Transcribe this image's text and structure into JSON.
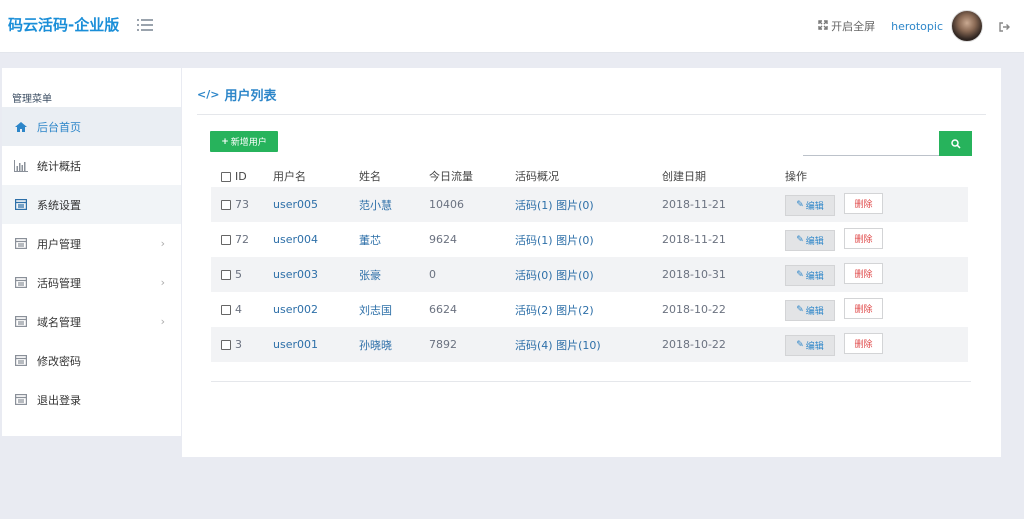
{
  "brand": "码云活码-企业版",
  "header": {
    "fullscreen_label": "开启全屏",
    "username": "herotopic"
  },
  "sidebar": {
    "title": "管理菜单",
    "items": [
      {
        "label": "后台首页",
        "icon": "home-icon"
      },
      {
        "label": "统计概括",
        "icon": "bar-chart-icon"
      },
      {
        "label": "系统设置",
        "icon": "panel-icon"
      },
      {
        "label": "用户管理",
        "icon": "panel-icon",
        "has_submenu": true
      },
      {
        "label": "活码管理",
        "icon": "panel-icon",
        "has_submenu": true
      },
      {
        "label": "域名管理",
        "icon": "panel-icon",
        "has_submenu": true
      },
      {
        "label": "修改密码",
        "icon": "panel-icon"
      },
      {
        "label": "退出登录",
        "icon": "panel-icon"
      }
    ]
  },
  "main": {
    "title": "用户列表",
    "add_button": "新增用户",
    "search_placeholder": "",
    "table": {
      "headers": [
        "ID",
        "用户名",
        "姓名",
        "今日流量",
        "活码概况",
        "创建日期",
        "操作"
      ],
      "rows": [
        {
          "id": "73",
          "username": "user005",
          "name": "范小慧",
          "traffic": "10406",
          "codes": "活码(1) 图片(0)",
          "date": "2018-11-21"
        },
        {
          "id": "72",
          "username": "user004",
          "name": "董芯",
          "traffic": "9624",
          "codes": "活码(1) 图片(0)",
          "date": "2018-11-21"
        },
        {
          "id": "5",
          "username": "user003",
          "name": "张豪",
          "traffic": "0",
          "codes": "活码(0) 图片(0)",
          "date": "2018-10-31"
        },
        {
          "id": "4",
          "username": "user002",
          "name": "刘志国",
          "traffic": "6624",
          "codes": "活码(2) 图片(2)",
          "date": "2018-10-22"
        },
        {
          "id": "3",
          "username": "user001",
          "name": "孙晓晓",
          "traffic": "7892",
          "codes": "活码(4) 图片(10)",
          "date": "2018-10-22"
        }
      ],
      "edit_label": "编辑",
      "delete_label": "删除"
    }
  },
  "colors": {
    "accent": "#2d86c9",
    "green": "#27b35c",
    "danger": "#e04a4a"
  }
}
